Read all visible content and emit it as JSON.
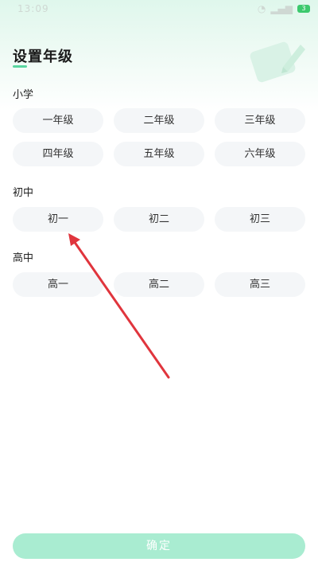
{
  "status_bar": {
    "time": "13:09",
    "battery": "3"
  },
  "page_title": "设置年级",
  "sections": [
    {
      "label": "小学",
      "grades": [
        "一年级",
        "二年级",
        "三年级",
        "四年级",
        "五年级",
        "六年级"
      ]
    },
    {
      "label": "初中",
      "grades": [
        "初一",
        "初二",
        "初三"
      ]
    },
    {
      "label": "高中",
      "grades": [
        "高一",
        "高二",
        "高三"
      ]
    }
  ],
  "confirm_label": "确定",
  "icons": {
    "decoration": "pencil-card-icon",
    "annotation": "red-arrow-pointer"
  },
  "colors": {
    "accent": "#5ad6a0",
    "confirm_bg": "#a9ecd1",
    "button_bg": "#f4f6f8",
    "arrow": "#e0353d"
  }
}
